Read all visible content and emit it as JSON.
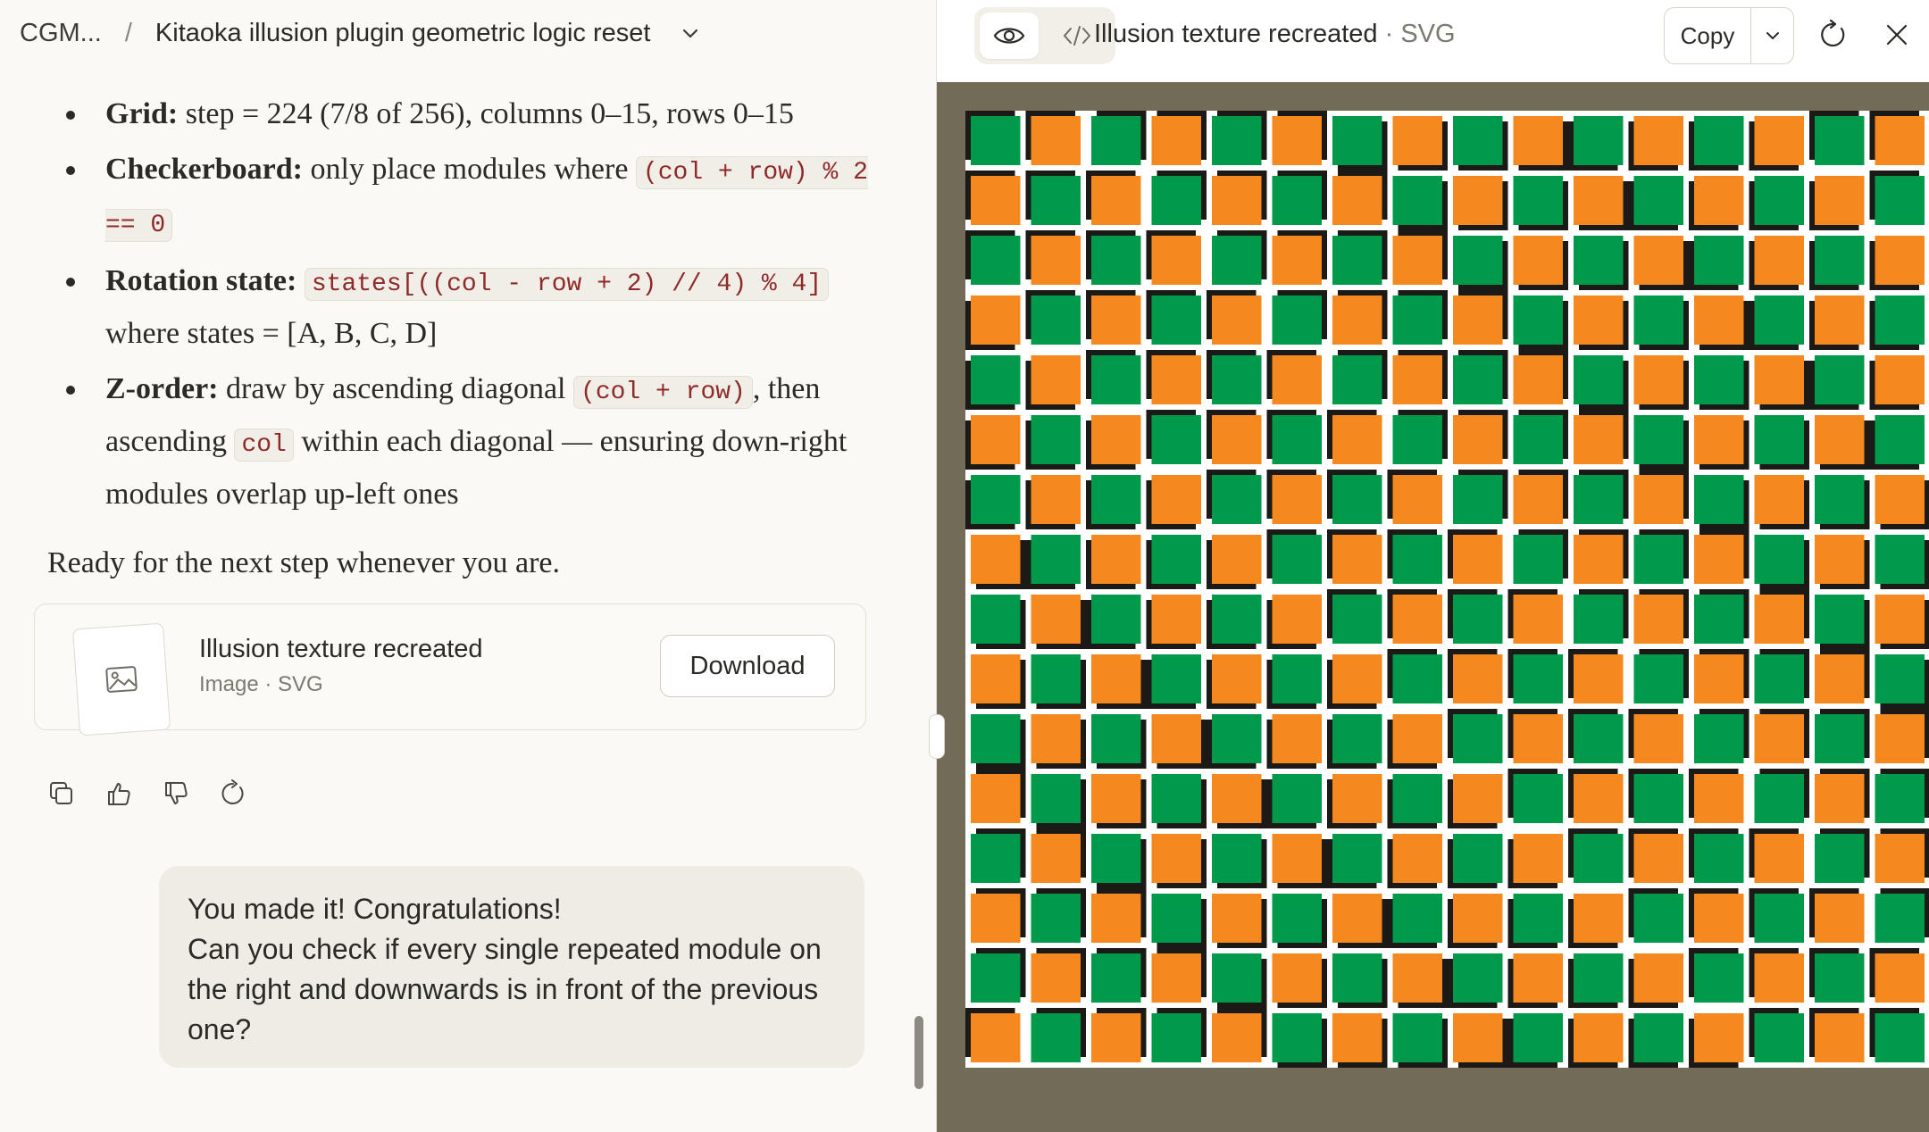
{
  "breadcrumb": {
    "root": "CGM...",
    "separator": "/",
    "title": "Kitaoka illusion plugin geometric logic reset"
  },
  "message": {
    "bullets": [
      {
        "label": "Grid:",
        "parts": [
          {
            "t": "text",
            "v": " step = 224 (7/8 of 256), columns 0–15, rows 0–15"
          }
        ]
      },
      {
        "label": "Checkerboard:",
        "parts": [
          {
            "t": "text",
            "v": " only place modules where "
          },
          {
            "t": "code",
            "v": "(col + row) % 2 == 0"
          }
        ]
      },
      {
        "label": "Rotation state:",
        "parts": [
          {
            "t": "text",
            "v": " "
          },
          {
            "t": "code",
            "v": "states[((col - row + 2) // 4) % 4]"
          },
          {
            "t": "text",
            "v": " where states = [A, B, C, D]"
          }
        ]
      },
      {
        "label": "Z-order:",
        "parts": [
          {
            "t": "text",
            "v": " draw by ascending diagonal "
          },
          {
            "t": "code",
            "v": "(col + row)"
          },
          {
            "t": "text",
            "v": ", then ascending "
          },
          {
            "t": "code",
            "v": "col"
          },
          {
            "t": "text",
            "v": " within each diagonal — ensuring down-right modules overlap up-left ones"
          }
        ]
      }
    ],
    "closing": "Ready for the next step whenever you are."
  },
  "artifact_card": {
    "title": "Illusion texture recreated",
    "subtitle": "Image · SVG",
    "download_label": "Download",
    "thumb_icon": "image-icon"
  },
  "message_actions": [
    "copy-icon",
    "thumbs-up-icon",
    "thumbs-down-icon",
    "retry-icon"
  ],
  "user_message": {
    "text": "You made it! Congratulations!\nCan you check if every single repeated module on the right and downwards is in front of the previous one?"
  },
  "preview_panel": {
    "title": "Illusion texture recreated",
    "title_suffix": "· SVG",
    "copy_label": "Copy",
    "view_toggle": [
      "eye-icon",
      "code-icon"
    ]
  },
  "texture": {
    "columns": 16,
    "rows": 16,
    "colors": {
      "background": "#726b57",
      "orange": "#f5891f",
      "green": "#009a4a",
      "outline": "#1c1a17",
      "gap": "#ffffff"
    }
  }
}
